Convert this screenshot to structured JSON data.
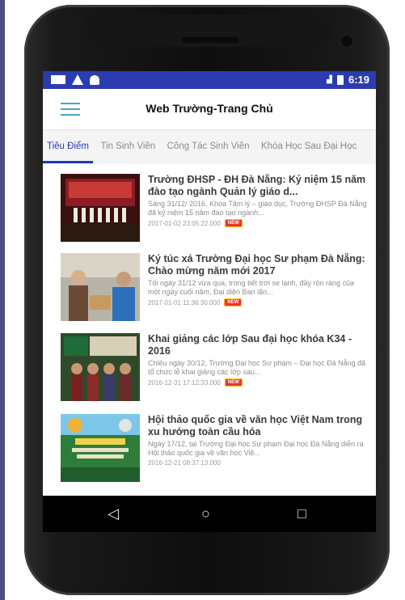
{
  "statusbar": {
    "signal_icon": "signal-icon",
    "time": "6:19"
  },
  "appbar": {
    "title": "Web Trường-Trang Chủ",
    "menu_icon": "hamburger-menu-icon"
  },
  "tabs": [
    {
      "label": "Tiêu Điểm",
      "active": true
    },
    {
      "label": "Tin Sinh Viên",
      "active": false
    },
    {
      "label": "Công Tác Sinh Viên",
      "active": false
    },
    {
      "label": "Khóa Học Sau Đại Học",
      "active": false
    }
  ],
  "articles": [
    {
      "title": "Trường ĐHSP - ĐH Đà Nẵng: Kỷ niệm 15 năm đào tạo ngành Quản lý giáo d...",
      "desc": "Sáng 31/12/ 2016, Khoa Tâm lý – giáo dục, Trường ĐHSP Đà Nẵng đã kỷ niệm 15 năm đào tạo ngành...",
      "date": "2017-01-02 23:05:22.000",
      "badge": "NEW"
    },
    {
      "title": "Ký túc xá Trường Đại học Sư phạm Đà Nẵng: Chào mừng năm mới 2017",
      "desc": "Tối ngày 31/12 vừa qua, trong tiết trời se lạnh, đầy rộn ràng của một ngày cuối năm, Đại diện Ban lãn...",
      "date": "2017-01-01 11:36:30.000",
      "badge": "NEW"
    },
    {
      "title": "Khai giảng các lớp Sau đại học khóa K34 - 2016",
      "desc": "Chiều ngày 30/12, Trường Đại học Sư phạm – Đại học Đà Nẵng đã tổ chức lễ khai giảng các lớp sau...",
      "date": "2016-12-31 17:12:33.000",
      "badge": "NEW"
    },
    {
      "title": "Hội thảo quốc gia về văn học Việt Nam trong xu hướng toàn cầu hóa",
      "desc": "Ngày 17/12, tại Trường Đại học Sư phạm Đại học Đà Nẵng diễn ra Hội thảo quốc gia về văn học Việ...",
      "date": "2016-12-21 08:37:13.000",
      "badge": ""
    }
  ],
  "navbar": {
    "back": "◁",
    "home": "○",
    "recents": "□"
  },
  "colors": {
    "statusbar": "#2c3bb0",
    "accent": "#1e3ab8",
    "badge": "#e33333"
  }
}
